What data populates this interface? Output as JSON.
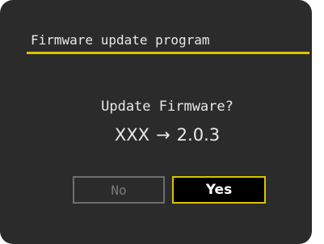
{
  "dialog": {
    "title": "Firmware update program",
    "question": "Update Firmware?",
    "version": {
      "current": "XXX",
      "arrow": "→",
      "target": "2.0.3"
    },
    "buttons": {
      "no_label": "No",
      "yes_label": "Yes",
      "selected": "Yes"
    }
  },
  "colors": {
    "background": "#2b2b2b",
    "accent": "#d8c400",
    "text": "#e8e8e8",
    "disabled_text": "#7a7a7a"
  }
}
